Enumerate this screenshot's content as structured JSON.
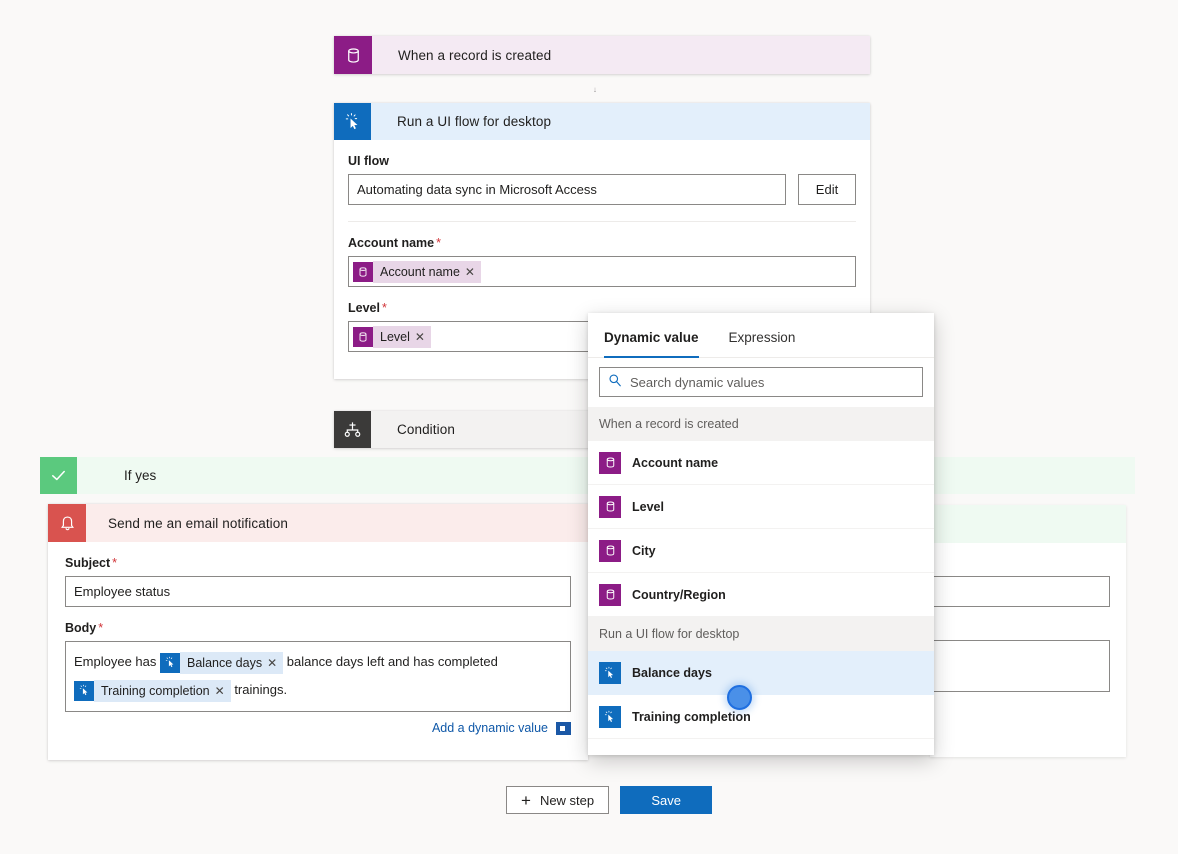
{
  "flow": {
    "trigger": {
      "title": "When a record is created",
      "icon": "database-icon"
    },
    "uiflow_action": {
      "title": "Run a UI flow for desktop",
      "icon": "ui-flow-cursor-icon",
      "fields": {
        "uiflow_label": "UI flow",
        "uiflow_value": "Automating data sync in Microsoft Access",
        "edit_button": "Edit",
        "account_name_label": "Account name",
        "account_name_token": "Account name",
        "level_label": "Level",
        "level_token": "Level",
        "required_marker": "*"
      }
    },
    "condition": {
      "title": "Condition",
      "icon": "condition-branch-icon"
    },
    "if_yes": {
      "label": "If yes",
      "icon": "checkmark-icon"
    },
    "email_action": {
      "title": "Send me an email notification",
      "icon": "bell-icon",
      "subject_label": "Subject",
      "subject_value": "Employee status",
      "body_label": "Body",
      "required_marker": "*",
      "body_parts": {
        "text_1": "Employee has",
        "token_1": "Balance days",
        "text_2": "balance days left and has completed",
        "token_2": "Training completion",
        "text_3": "trainings."
      },
      "add_dynamic_value": "Add a dynamic value"
    }
  },
  "dynamic_panel": {
    "tabs": [
      {
        "label": "Dynamic value",
        "active": true
      },
      {
        "label": "Expression",
        "active": false
      }
    ],
    "search_placeholder": "Search dynamic values",
    "search_icon": "search-icon",
    "groups": [
      {
        "name": "When a record is created",
        "items": [
          {
            "label": "Account name",
            "icon": "database-icon",
            "highlighted": false
          },
          {
            "label": "Level",
            "icon": "database-icon",
            "highlighted": false
          },
          {
            "label": "City",
            "icon": "database-icon",
            "highlighted": false
          },
          {
            "label": "Country/Region",
            "icon": "database-icon",
            "highlighted": false
          }
        ]
      },
      {
        "name": "Run a UI flow for desktop",
        "items": [
          {
            "label": "Balance days",
            "icon": "ui-flow-cursor-icon",
            "highlighted": true
          },
          {
            "label": "Training completion",
            "icon": "ui-flow-cursor-icon",
            "highlighted": false
          }
        ]
      }
    ]
  },
  "footer": {
    "new_step": "New step",
    "save": "Save"
  },
  "colors": {
    "trigger_purple": "#8c1c86",
    "trigger_band": "#f4eaf3",
    "action_blue": "#0f6cbd",
    "action_band": "#e3effb",
    "condition_dark": "#3b3a39",
    "if_yes_green": "#5bc97e",
    "if_yes_band": "#effaf2",
    "email_red": "#d9534f",
    "email_band": "#fbeceb",
    "link_blue": "#0f58a8",
    "required_red": "#d13438"
  }
}
